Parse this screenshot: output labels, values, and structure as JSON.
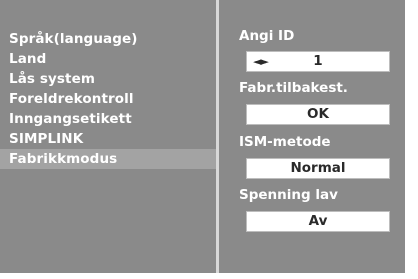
{
  "menu": {
    "items": [
      {
        "label": "Språk(language)"
      },
      {
        "label": "Land"
      },
      {
        "label": "Lås system"
      },
      {
        "label": "Foreldrekontroll"
      },
      {
        "label": "Inngangsetikett"
      },
      {
        "label": "SIMPLINK"
      },
      {
        "label": "Fabrikkmodus"
      }
    ],
    "selected": "Fabrikkmodus"
  },
  "settings": {
    "id": {
      "label": "Angi ID",
      "value": "1",
      "arrows_icon": "left-right-arrows-icon"
    },
    "factory_reset": {
      "label": "Fabr.tilbakest.",
      "value": "OK"
    },
    "ism": {
      "label": "ISM-metode",
      "value": "Normal"
    },
    "low_power": {
      "label": "Spenning lav",
      "value": "Av"
    }
  },
  "colors": {
    "background": "#8a8a8a",
    "highlight": "#a3a3a3",
    "divider": "#d8d8d8",
    "text": "#ffffff",
    "value_text": "#2a2a2a"
  }
}
